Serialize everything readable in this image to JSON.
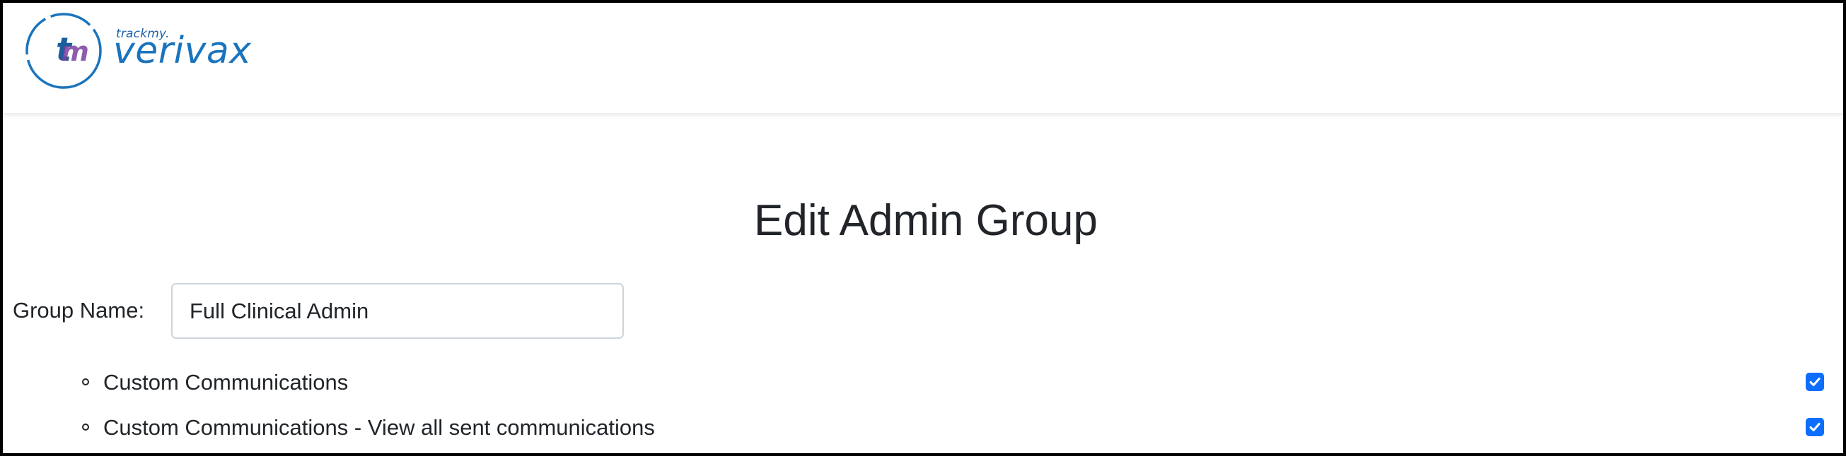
{
  "header": {
    "logo_monogram": "tm",
    "logo_tagline": "trackmy.",
    "logo_brand": "verivax",
    "brand_color": "#1a74bd",
    "accent_color": "#7b3fa0"
  },
  "page": {
    "title": "Edit Admin Group"
  },
  "form": {
    "group_name_label": "Group Name:",
    "group_name_value": "Full Clinical Admin"
  },
  "permissions": [
    {
      "label": "Custom Communications",
      "checked": true
    },
    {
      "label": "Custom Communications - View all sent communications",
      "checked": true
    }
  ],
  "colors": {
    "checkbox": "#0d6efd",
    "text": "#212529",
    "input_border": "#ced4da"
  }
}
